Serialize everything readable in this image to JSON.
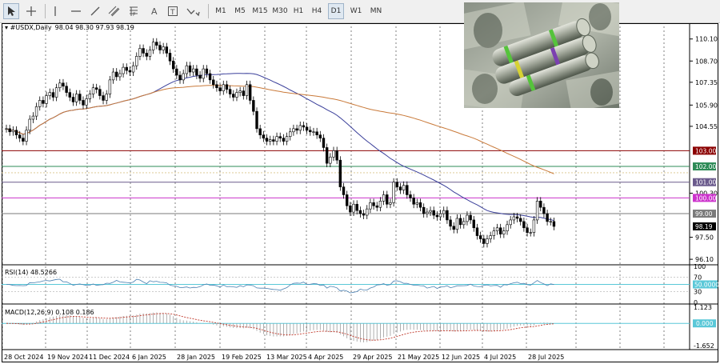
{
  "toolbar": {
    "timeframes": [
      "M1",
      "M5",
      "M15",
      "M30",
      "H1",
      "H4",
      "D1",
      "W1",
      "MN"
    ],
    "active_timeframe": "D1"
  },
  "chart_header": {
    "symbol": "#USDX,Daily",
    "ohlc": "98.04 98.30 97.93 98.19"
  },
  "price_axis": {
    "ticks": [
      "110.10",
      "108.70",
      "107.35",
      "105.90",
      "104.55",
      "100.30",
      "97.50",
      "96.10"
    ],
    "tags": [
      {
        "text": "103.00",
        "color": "#8b0000",
        "text_color": "#ffffff"
      },
      {
        "text": "102.00",
        "color": "#2e8b57",
        "text_color": "#ffffff"
      },
      {
        "text": "101.00",
        "color": "#6a5a8c",
        "text_color": "#ffffff"
      },
      {
        "text": "100.00",
        "color": "#cc33cc",
        "text_color": "#ffffff"
      },
      {
        "text": "99.00",
        "color": "#7a7a7a",
        "text_color": "#ffffff"
      },
      {
        "text": "98.19",
        "color": "#000000",
        "text_color": "#ffffff"
      }
    ]
  },
  "rsi": {
    "label": "RSI(14) 48.5266",
    "ticks": [
      "100",
      "70",
      "30",
      "0"
    ],
    "tag": "50.0000"
  },
  "macd": {
    "label": "MACD(12,26,9) 0.108 0.186",
    "ticks": [
      "1.123",
      "-1.652"
    ],
    "tag": "0.000"
  },
  "time_axis": [
    "28 Oct 2024",
    "19 Nov 2024",
    "11 Dec 2024",
    "6 Jan 2025",
    "28 Jan 2025",
    "19 Feb 2025",
    "13 Mar 2025",
    "4 Apr 2025",
    "29 Apr 2025",
    "21 May 2025",
    "12 Jun 2025",
    "4 Jul 2025",
    "28 Jul 2025"
  ],
  "chart_data": {
    "type": "candlestick",
    "title": "#USDX,Daily",
    "ylim": [
      95.8,
      110.9
    ],
    "horizontal_levels": [
      103.0,
      102.0,
      101.0,
      100.0,
      99.0
    ],
    "close": [
      104.4,
      104.2,
      104.3,
      104.0,
      103.8,
      103.6,
      104.3,
      105.0,
      105.2,
      105.8,
      106.2,
      106.0,
      106.5,
      106.7,
      106.4,
      107.0,
      107.3,
      107.1,
      106.7,
      106.4,
      106.1,
      106.6,
      106.2,
      105.9,
      106.3,
      106.6,
      107.0,
      106.9,
      106.5,
      106.2,
      106.6,
      107.5,
      108.0,
      107.7,
      107.9,
      108.3,
      108.1,
      108.0,
      108.4,
      109.0,
      109.5,
      109.2,
      109.0,
      109.4,
      109.9,
      109.7,
      109.4,
      109.6,
      109.2,
      108.7,
      108.2,
      107.8,
      107.5,
      107.9,
      108.4,
      108.0,
      108.2,
      107.8,
      107.6,
      108.2,
      107.9,
      107.5,
      107.2,
      107.0,
      106.8,
      107.2,
      106.9,
      106.6,
      106.4,
      106.7,
      106.8,
      106.5,
      107.2,
      106.2,
      105.5,
      104.4,
      104.0,
      103.8,
      103.6,
      103.7,
      103.6,
      103.9,
      103.8,
      103.6,
      103.9,
      104.2,
      104.4,
      104.3,
      104.6,
      104.5,
      104.3,
      104.2,
      104.2,
      104.0,
      103.8,
      103.2,
      102.2,
      102.6,
      103.0,
      102.4,
      100.7,
      100.2,
      99.5,
      99.1,
      99.6,
      99.2,
      99.0,
      98.9,
      99.3,
      99.7,
      99.5,
      99.4,
      99.8,
      100.2,
      99.6,
      99.7,
      101.0,
      100.7,
      100.5,
      100.8,
      100.2,
      100.0,
      99.6,
      99.7,
      99.4,
      99.0,
      99.1,
      99.2,
      98.9,
      98.8,
      99.0,
      99.2,
      98.6,
      98.2,
      98.0,
      98.7,
      98.3,
      98.5,
      98.9,
      98.6,
      98.1,
      97.6,
      97.4,
      97.1,
      97.4,
      97.6,
      97.9,
      98.1,
      97.7,
      97.9,
      98.3,
      98.6,
      98.8,
      98.7,
      98.5,
      98.1,
      97.8,
      97.8,
      98.6,
      99.8,
      99.4,
      99.0,
      98.5,
      98.5,
      98.19
    ],
    "ma_slow_label": "blue moving average",
    "rsi_value": 48.5266,
    "rsi_levels": [
      70,
      50,
      30
    ],
    "macd_value": 0.108,
    "macd_signal": 0.186,
    "macd_range": [
      -1.652,
      1.123
    ]
  }
}
